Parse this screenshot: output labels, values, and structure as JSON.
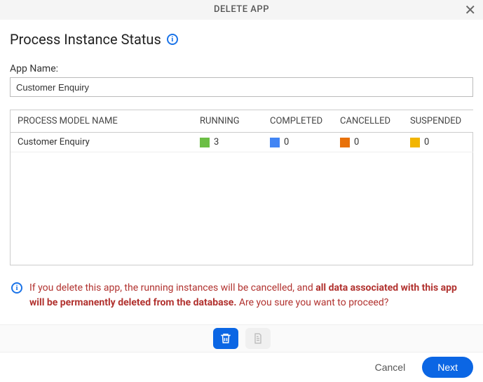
{
  "dialog": {
    "title": "DELETE APP"
  },
  "section": {
    "title": "Process Instance Status"
  },
  "form": {
    "app_name_label": "App Name:",
    "app_name_value": "Customer Enquiry"
  },
  "table": {
    "headers": {
      "name": "PROCESS MODEL NAME",
      "running": "RUNNING",
      "completed": "COMPLETED",
      "cancelled": "CANCELLED",
      "suspended": "SUSPENDED"
    },
    "rows": [
      {
        "name": "Customer Enquiry",
        "running": "3",
        "completed": "0",
        "cancelled": "0",
        "suspended": "0"
      }
    ]
  },
  "warning": {
    "pre": "If you delete this app, the running instances will be cancelled, and ",
    "bold": "all data associated with this app will be permanently deleted from the database.",
    "post": " Are you sure you want to proceed?"
  },
  "footer": {
    "cancel": "Cancel",
    "next": "Next"
  }
}
